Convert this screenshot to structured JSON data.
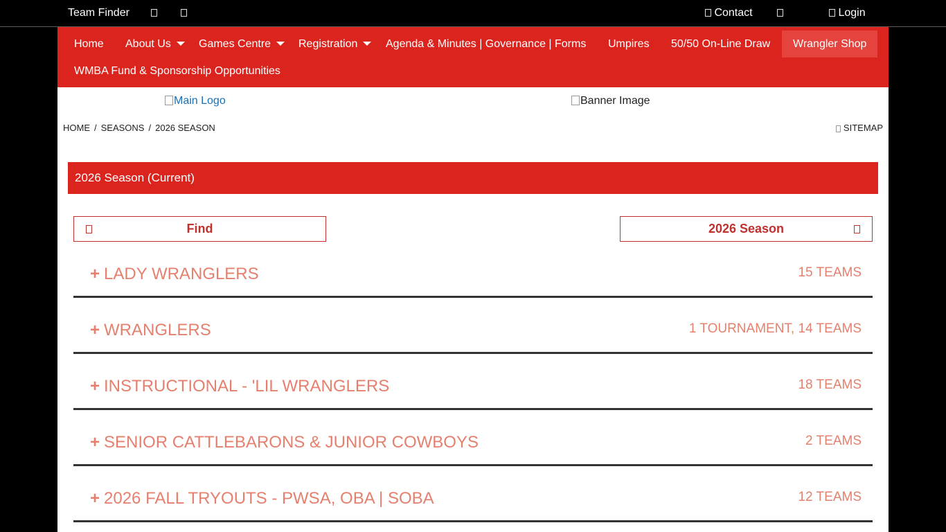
{
  "topbar": {
    "team_finder": "Team Finder",
    "contact": "Contact",
    "login": "Login"
  },
  "nav": {
    "items": [
      {
        "label": "Home"
      },
      {
        "label": "About Us"
      },
      {
        "label": "Games Centre"
      },
      {
        "label": "Registration"
      },
      {
        "label": "Agenda & Minutes | Governance | Forms"
      },
      {
        "label": "Umpires"
      },
      {
        "label": "50/50 On-Line Draw"
      },
      {
        "label": "Wrangler Shop"
      },
      {
        "label": "WMBA Fund & Sponsorship Opportunities"
      }
    ]
  },
  "header": {
    "main_logo_alt": "Main Logo",
    "banner_alt": "Banner Image"
  },
  "breadcrumb": {
    "items": [
      "HOME",
      "SEASONS",
      "2026 SEASON"
    ],
    "sep": "/",
    "sitemap": "SITEMAP"
  },
  "season": {
    "title": "2026 Season (Current)",
    "find_label": "Find",
    "selector_label": "2026 Season"
  },
  "groups": [
    {
      "name": "LADY WRANGLERS",
      "count": "15 TEAMS"
    },
    {
      "name": "WRANGLERS",
      "count": "1 TOURNAMENT, 14 TEAMS"
    },
    {
      "name": "INSTRUCTIONAL - 'LIL WRANGLERS",
      "count": "18 TEAMS"
    },
    {
      "name": "SENIOR CATTLEBARONS & JUNIOR COWBOYS",
      "count": "2 TEAMS"
    },
    {
      "name": "2026 FALL TRYOUTS - PWSA, OBA | SOBA",
      "count": "12 TEAMS"
    }
  ],
  "colors": {
    "brand_red": "#dc241f",
    "group_text": "#e5806f"
  },
  "icons": {
    "expand": "+",
    "topbar_icons": [
      "search-icon",
      "social-icon",
      "envelope-icon",
      "user-icon",
      "lock-icon"
    ]
  }
}
